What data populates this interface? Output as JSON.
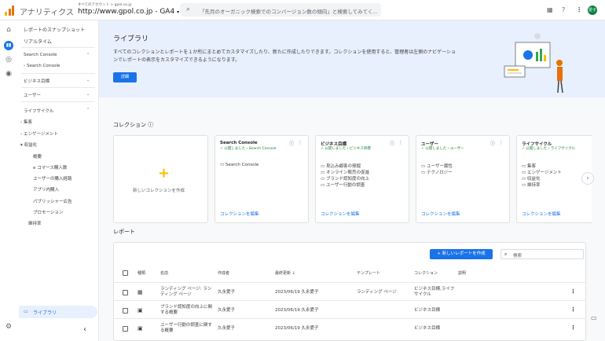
{
  "header": {
    "app_name": "アナリティクス",
    "account_crumb": "すべてのアカウント > gpol.co.jp",
    "property_name": "http://www.gpol.co.jp - GA4",
    "search_placeholder": "「先月のオーガニック検索でのコンバージョン数の傾向」と検索してみてく...",
    "avatar_initials": "愛子"
  },
  "rail": {
    "icons": [
      "home-icon",
      "reports-icon",
      "explore-icon",
      "advertising-icon",
      "settings-icon"
    ]
  },
  "sidenav": {
    "snapshot": "レポートのスナップショット",
    "realtime": "リアルタイム",
    "sc_section": "Search Console",
    "sc_item": "Search Console",
    "biz_section": "ビジネス目標",
    "user_section": "ユーザー",
    "life_section": "ライフサイクル",
    "acq": "集客",
    "engage": "エンゲージメント",
    "monet": "収益化",
    "monet_items": [
      "概要",
      "e コマース購入数",
      "ユーザーの購入経路",
      "アプリ内購入",
      "パブリッシャー広告",
      "プロモーション"
    ],
    "retention": "維持率",
    "library": "ライブラリ",
    "collapse": "‹"
  },
  "banner": {
    "title": "ライブラリ",
    "desc": "すべてのコレクションとレポートを１か所にまとめてカスタマイズしたり、新たに作成したりできます。コレクションを使用すると、管理者は左側のナビゲーションでレポートの表示をカスタマイズできるようになります。",
    "details_btn": "詳細"
  },
  "collections": {
    "title": "コレクション",
    "new_label": "新しいコレクションを作成",
    "edit_label": "コレクションを編集",
    "cards": [
      {
        "title": "Search Console",
        "status": "公開しました・Search Console",
        "items": [
          "Search Console"
        ]
      },
      {
        "title": "ビジネス目標",
        "status": "公開しました・ビジネス目標",
        "items": [
          "見込み顧客の発掘",
          "オンライン販売の促進",
          "ブランド認知度の向上",
          "ユーザー行動の調査"
        ]
      },
      {
        "title": "ユーザー",
        "status": "公開しました・ユーザー",
        "items": [
          "ユーザー属性",
          "テクノロジー"
        ]
      },
      {
        "title": "ライフサイクル",
        "status": "公開しました・ライフサイクル",
        "items": [
          "集客",
          "エンゲージメント",
          "収益化",
          "維持率"
        ]
      }
    ]
  },
  "reports": {
    "title": "レポート",
    "new_btn": "新しいレポートを作成",
    "search_placeholder": "検索",
    "columns": [
      "種類",
      "名前",
      "作成者",
      "最終更新",
      "テンプレート",
      "コレクション",
      "説明"
    ],
    "rows": [
      {
        "name": "ランディング ページ: ランディング ページ",
        "creator": "久永愛子",
        "updated": "2023/06/19 久永愛子",
        "template": "ランディング ページ",
        "collection": "ビジネス目標,ライフサイクル",
        "desc": ""
      },
      {
        "name": "ブランド認知度の向上に関する概要",
        "creator": "久永愛子",
        "updated": "2023/06/19 久永愛子",
        "template": "",
        "collection": "ビジネス目標",
        "desc": ""
      },
      {
        "name": "ユーザー行動の調査に関する概要",
        "creator": "久永愛子",
        "updated": "2023/06/19 久永愛子",
        "template": "",
        "collection": "ビジネス目標",
        "desc": ""
      }
    ]
  },
  "colors": {
    "accent": "#1a73e8",
    "banner_bg": "#e8f0fe",
    "status_green": "#188038"
  }
}
